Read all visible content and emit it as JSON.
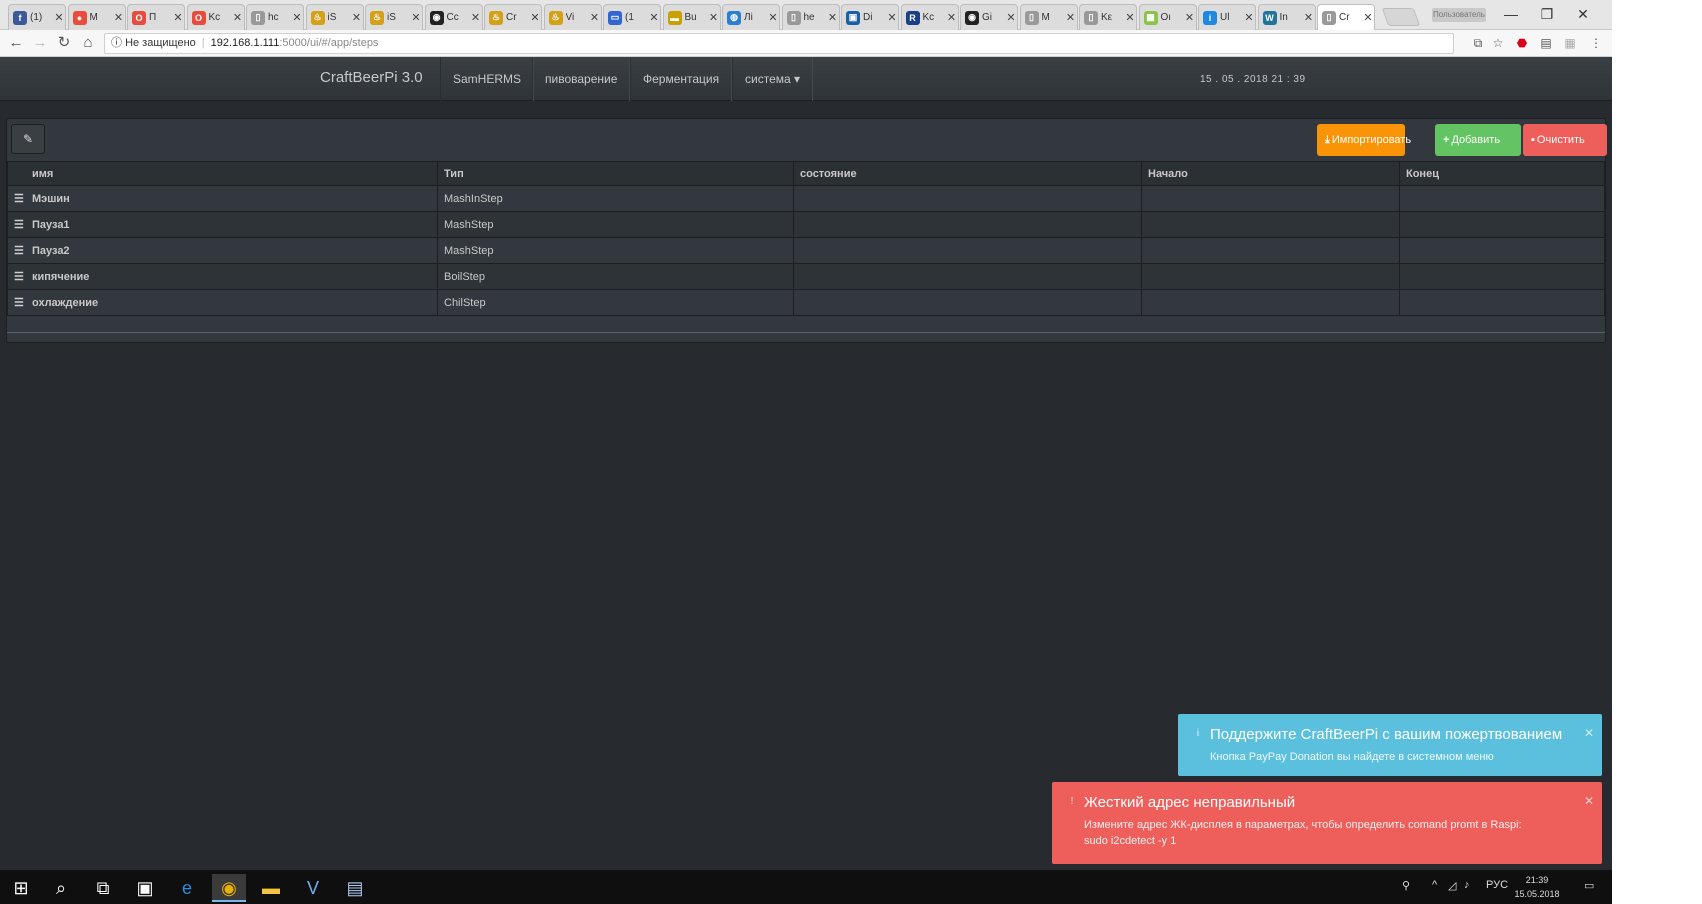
{
  "browser": {
    "tabs": [
      {
        "label": "(1)",
        "icon": "facebook-icon",
        "color": "#3b5998",
        "glyph": "f"
      },
      {
        "label": "M",
        "icon": "circle-red-icon",
        "color": "#e74c3c",
        "glyph": "●"
      },
      {
        "label": "П",
        "icon": "opera-icon",
        "color": "#e74c3c",
        "glyph": "O"
      },
      {
        "label": "Kc",
        "icon": "opera-icon",
        "color": "#e74c3c",
        "glyph": "O"
      },
      {
        "label": "hc",
        "icon": "page-icon",
        "color": "#999999",
        "glyph": "▯"
      },
      {
        "label": "iS",
        "icon": "beer-icon",
        "color": "#d4a017",
        "glyph": "♨"
      },
      {
        "label": "iS",
        "icon": "beer-icon",
        "color": "#d4a017",
        "glyph": "♨"
      },
      {
        "label": "Cc",
        "icon": "github-icon",
        "color": "#222222",
        "glyph": "◉"
      },
      {
        "label": "Cr",
        "icon": "beer-icon",
        "color": "#d4a017",
        "glyph": "♨"
      },
      {
        "label": "Vi",
        "icon": "beer-icon",
        "color": "#d4a017",
        "glyph": "♨"
      },
      {
        "label": "(1",
        "icon": "chat-icon",
        "color": "#3366cc",
        "glyph": "▭"
      },
      {
        "label": "Bu",
        "icon": "site-icon",
        "color": "#c8a000",
        "glyph": "▬"
      },
      {
        "label": "Лі",
        "icon": "globe-icon",
        "color": "#2a7fd4",
        "glyph": "◍"
      },
      {
        "label": "he",
        "icon": "page-icon",
        "color": "#999999",
        "glyph": "▯"
      },
      {
        "label": "Di",
        "icon": "site-icon",
        "color": "#1a5fa8",
        "glyph": "▣"
      },
      {
        "label": "Kc",
        "icon": "rp-icon",
        "color": "#1a3f8a",
        "glyph": "R"
      },
      {
        "label": "Gi",
        "icon": "github-icon",
        "color": "#222222",
        "glyph": "◉"
      },
      {
        "label": "M",
        "icon": "page-icon",
        "color": "#999999",
        "glyph": "▯"
      },
      {
        "label": "Kε",
        "icon": "page-icon",
        "color": "#999999",
        "glyph": "▯"
      },
      {
        "label": "Oı",
        "icon": "grid-icon",
        "color": "#8bc34a",
        "glyph": "▦"
      },
      {
        "label": "Ul",
        "icon": "info-icon",
        "color": "#1e88e5",
        "glyph": "i"
      },
      {
        "label": "In",
        "icon": "wordpress-icon",
        "color": "#21759b",
        "glyph": "W"
      },
      {
        "label": "Cr",
        "icon": "page-icon",
        "color": "#999999",
        "glyph": "▯",
        "active": true
      }
    ],
    "profile_label": "Пользователь",
    "window": {
      "minimize": "—",
      "restore": "❐",
      "close": "✕"
    },
    "security_label": "Не защищено",
    "url_host": "192.168.1.111",
    "url_path": ":5000/ui/#/app/steps"
  },
  "navbar": {
    "brand": "CraftBeerPi 3.0",
    "items": [
      {
        "label": "SamHERMS"
      },
      {
        "label": "пивоварение"
      },
      {
        "label": "Ферментация"
      },
      {
        "label": "система ▾"
      }
    ],
    "clock": "15 . 05 . 2018 21 : 39"
  },
  "steps": {
    "buttons": {
      "import": "Импортировать",
      "add": "Добавить",
      "clear": "Очистить"
    },
    "columns": [
      "имя",
      "Тип",
      "состояние",
      "Начало",
      "Конец"
    ],
    "rows": [
      {
        "name": "Мэшин",
        "type": "MashInStep",
        "state": "",
        "start": "",
        "end": ""
      },
      {
        "name": "Пауза1",
        "type": "MashStep",
        "state": "",
        "start": "",
        "end": ""
      },
      {
        "name": "Пауза2",
        "type": "MashStep",
        "state": "",
        "start": "",
        "end": ""
      },
      {
        "name": "кипячение",
        "type": "BoilStep",
        "state": "",
        "start": "",
        "end": ""
      },
      {
        "name": "охлаждение",
        "type": "ChilStep",
        "state": "",
        "start": "",
        "end": ""
      }
    ]
  },
  "notifications": {
    "info": {
      "title": "Поддержите CraftBeerPi с вашим пожертвованием",
      "body": "Кнопка PayPay Donation вы найдете в системном меню"
    },
    "error": {
      "title": "Жесткий адрес неправильный",
      "body_line1": "Измените адрес ЖК-дисплея в параметрах, чтобы определить comand promt в Raspi:",
      "body_line2": "sudo i2cdetect -y 1"
    }
  },
  "taskbar": {
    "lang": "РУС",
    "time": "21:39",
    "date": "15.05.2018"
  },
  "colors": {
    "import": "#f89406",
    "add": "#62c462",
    "clear": "#ee5f5b",
    "info": "#5bc0de",
    "error": "#ee5f5b",
    "background": "#272b30"
  }
}
